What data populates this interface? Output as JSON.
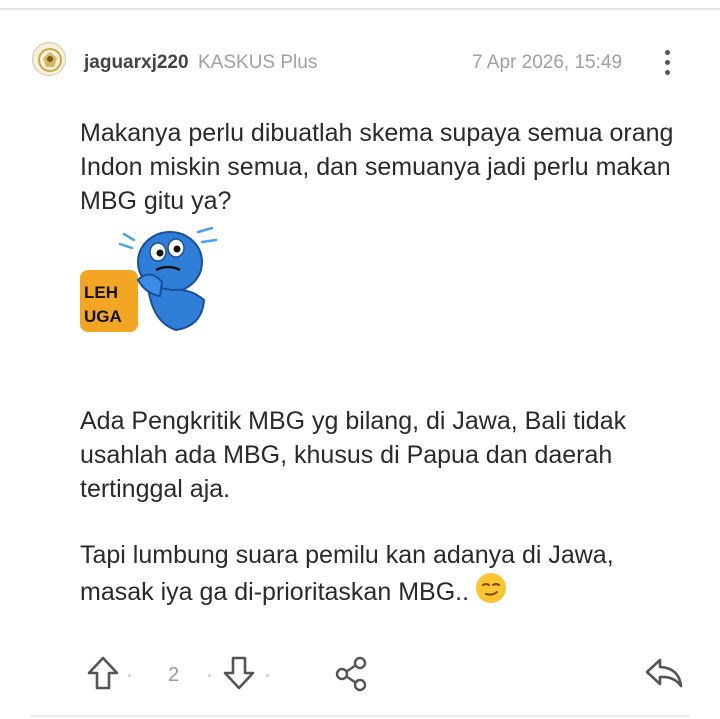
{
  "post": {
    "username": "jaguarxj220",
    "badge": "KASKUS Plus",
    "timestamp": "7 Apr 2026, 15:49",
    "paragraph1": "Makanya perlu dibuatlah skema supaya semua orang Indon miskin semua, dan semuanya jadi perlu makan MBG gitu ya?",
    "sticker_text_line1": "LEH",
    "sticker_text_line2": "UGA",
    "paragraph2": "Ada Pengkritik MBG yg bilang, di Jawa, Bali tidak usahlah ada MBG, khusus di Papua dan daerah tertinggal aja.",
    "paragraph3": "Tapi lumbung suara pemilu kan adanya di Jawa, masak iya ga di-prioritaskan MBG.."
  },
  "actions": {
    "vote_count": "2"
  },
  "colors": {
    "sticker_blue": "#2f7fd8",
    "sticker_orange": "#f2a623",
    "meta_gray": "#a0a0a0",
    "icon_gray": "#555555"
  },
  "icons": [
    "avatar",
    "more-vertical-icon",
    "arrow-up-icon",
    "arrow-down-icon",
    "share-icon",
    "reply-icon",
    "smirk-emoji"
  ]
}
